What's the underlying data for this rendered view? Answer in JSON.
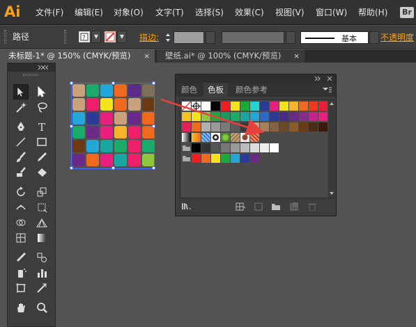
{
  "app": {
    "logo": "Ai"
  },
  "menu": {
    "items": [
      "文件(F)",
      "编辑(E)",
      "对象(O)",
      "文字(T)",
      "选择(S)",
      "效果(C)",
      "视图(V)",
      "窗口(W)",
      "帮助(H)"
    ],
    "badge": "Br"
  },
  "control_bar": {
    "selection_label": "路径",
    "fill_icon": "question-mark-swatch",
    "stroke_icon": "none-swatch",
    "stroke_label": "描边:",
    "brush_label": "基本",
    "opacity_label": "不透明度"
  },
  "tabs": [
    {
      "label": "未标题-1* @ 150% (CMYK/预览)",
      "close": "×"
    },
    {
      "label": "壁纸.ai* @ 100% (CMYK/预览)",
      "close": "×"
    }
  ],
  "swatches_panel": {
    "tabs": [
      "颜色",
      "色板",
      "颜色参考"
    ],
    "active_tab": "色板"
  },
  "colors": {
    "accent": "#f7a21b",
    "selection": "#4a6cff",
    "arrow": "#e8413b"
  },
  "artwork_colors": [
    [
      "#c9a27c",
      "#1aaa6a",
      "#23a6d8",
      "#ef6a1f",
      "#5b2a8a",
      "#7d6f5a"
    ],
    [
      "#c9a27c",
      "#ef1f6a",
      "#f5e21f",
      "#ef6a1f",
      "#c9a27c",
      "#6b3a12"
    ],
    [
      "#23a6d8",
      "#2c3a9a",
      "#e81f7f",
      "#c9a27c",
      "#6b2a8a",
      "#ef6a1f"
    ],
    [
      "#1aaa6a",
      "#6b2a8a",
      "#e81f7f",
      "#f5b42a",
      "#ef1f6a",
      "#ef6a1f"
    ],
    [
      "#6b3a12",
      "#23a6d8",
      "#1aa6a0",
      "#1aaa6a",
      "#ef1f6a",
      "#1aaa6a"
    ],
    [
      "#6b2a8a",
      "#ef6a1f",
      "#e81f7f",
      "#1aa6a0",
      "#ef1f6a",
      "#8dc63f"
    ]
  ],
  "swatch_rows": [
    [
      "none",
      "reg",
      "#ffffff",
      "#000000",
      "#ef1f1f",
      "#f5e21f",
      "#1aaa3a",
      "#23d4d4",
      "#2c3a9a",
      "#e81f7f",
      "#f5e21f",
      "#f5b42a",
      "#ef6a1f",
      "#ef3a1f",
      "#e81f3a"
    ],
    [
      "#f7c21f",
      "#f5e21f",
      "#8dc63f",
      "#1aaa3a",
      "#1a9a5a",
      "#1aaa6a",
      "#1aa6a0",
      "#23a6d8",
      "#2c6ac8",
      "#2c3a9a",
      "#4a2a8a",
      "#6b2a8a",
      "#8a2a8a",
      "#c81f8a",
      "#e81f7f"
    ],
    [
      "#e81f5a",
      "#ef6a1f",
      "#b0b0b0",
      "#9a9a9a",
      "#7a7a7a",
      "#5a5a5a",
      "#3a3a3a",
      "#c9a27c",
      "#a88058",
      "#8a6040",
      "#6b4a2a",
      "#8a5a2a",
      "#6b3a12",
      "#4a2a12",
      "#3a1a0a"
    ],
    [
      "grad-bw",
      "grad-orange",
      "pat-blue",
      "pat-circle",
      "pat-green",
      "pat-leaf",
      "pat-brown",
      "pat-red"
    ],
    [
      "folder",
      "#000000",
      "#333333",
      "#555555",
      "#777777",
      "#999999",
      "#bbbbbb",
      "#dddddd",
      "#eeeeee",
      "#ffffff"
    ],
    [
      "folder",
      "#ef1f1f",
      "#ef6a1f",
      "#f5e21f",
      "#1aaa3a",
      "#23a6d8",
      "#2c3a9a",
      "#6b2a8a"
    ]
  ]
}
